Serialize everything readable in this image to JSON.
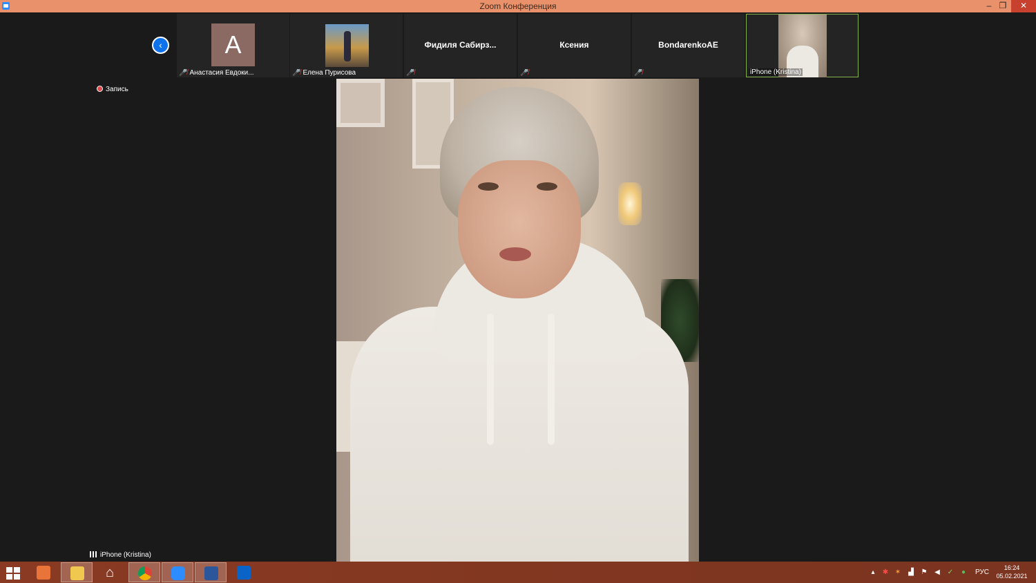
{
  "window": {
    "title": "Zoom Конференция",
    "minimize_glyph": "–",
    "restore_glyph": "❐",
    "close_glyph": "✕"
  },
  "strip": {
    "nav_glyph": "‹",
    "participants": [
      {
        "name": "Анастасия Евдоки...",
        "avatar_letter": "A",
        "muted": true
      },
      {
        "name": "Елена Пурисова",
        "muted": true
      },
      {
        "name": "Фидиля  Сабирз...",
        "muted": true
      },
      {
        "name": "Ксения",
        "muted": true
      },
      {
        "name": "BondarenkoAE",
        "muted": true
      },
      {
        "name": "iPhone (Kristina)",
        "muted": false,
        "active": true
      }
    ]
  },
  "recording": {
    "label": "Запись"
  },
  "active_speaker": {
    "name": "iPhone (Kristina)"
  },
  "taskbar": {
    "apps": [
      "start",
      "media-player",
      "file-explorer",
      "home",
      "chrome",
      "zoom",
      "word",
      "outlook"
    ],
    "tray": {
      "language": "РУС",
      "time": "16:24",
      "date": "05.02.2021"
    }
  },
  "colors": {
    "titlebar": "#e8916a",
    "accent": "#0e72ed",
    "active_border": "#86b34a",
    "taskbar": "#8a3a22"
  }
}
